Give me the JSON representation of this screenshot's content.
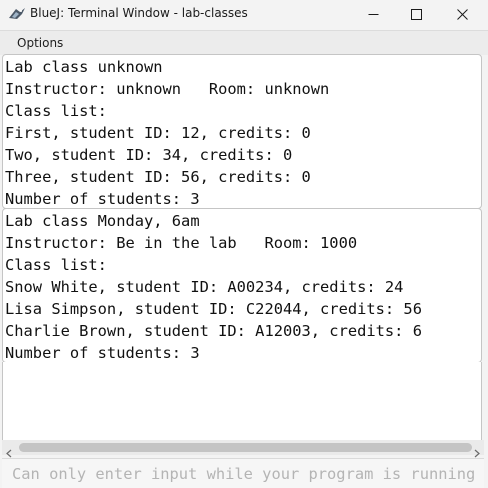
{
  "window": {
    "title": "BlueJ: Terminal Window - lab-classes",
    "app_icon": "bluej-bird-icon",
    "controls": [
      "minimize-icon",
      "maximize-icon",
      "close-icon"
    ]
  },
  "menu": {
    "options_label": "Options"
  },
  "output": {
    "blocks": [
      {
        "lines": [
          "Lab class unknown",
          "Instructor: unknown   Room: unknown",
          "Class list:",
          "First, student ID: 12, credits: 0",
          "Two, student ID: 34, credits: 0",
          "Three, student ID: 56, credits: 0",
          "Number of students: 3"
        ]
      },
      {
        "lines": [
          "Lab class Monday, 6am",
          "Instructor: Be in the lab   Room: 1000",
          "Class list:",
          "Snow White, student ID: A00234, credits: 24",
          "Lisa Simpson, student ID: C22044, credits: 56",
          "Charlie Brown, student ID: A12003, credits: 6",
          "Number of students: 3"
        ]
      }
    ]
  },
  "input": {
    "placeholder": "Can only enter input while your program is running"
  }
}
